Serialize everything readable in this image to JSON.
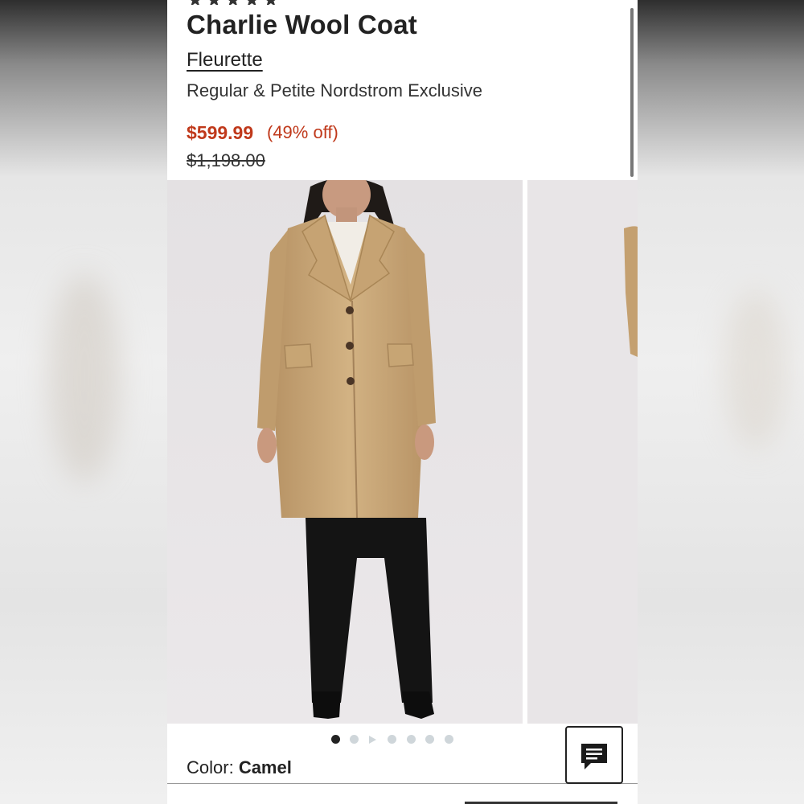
{
  "product": {
    "title": "Charlie Wool Coat",
    "brand": "Fleurette",
    "subtitle": "Regular & Petite Nordstrom Exclusive",
    "price_sale": "$599.99",
    "price_discount": "(49% off)",
    "price_original": "$1,198.00",
    "rating_icon": "star-rating-icon"
  },
  "gallery": {
    "dots_count": 7,
    "active_dot": 0,
    "video_dot_index": 2
  },
  "color": {
    "label": "Color:",
    "value": "Camel"
  },
  "chat": {
    "icon": "chat-icon"
  },
  "colors": {
    "sale_red": "#c0391b",
    "coat_camel": "#c9a77a",
    "text": "#222222"
  }
}
